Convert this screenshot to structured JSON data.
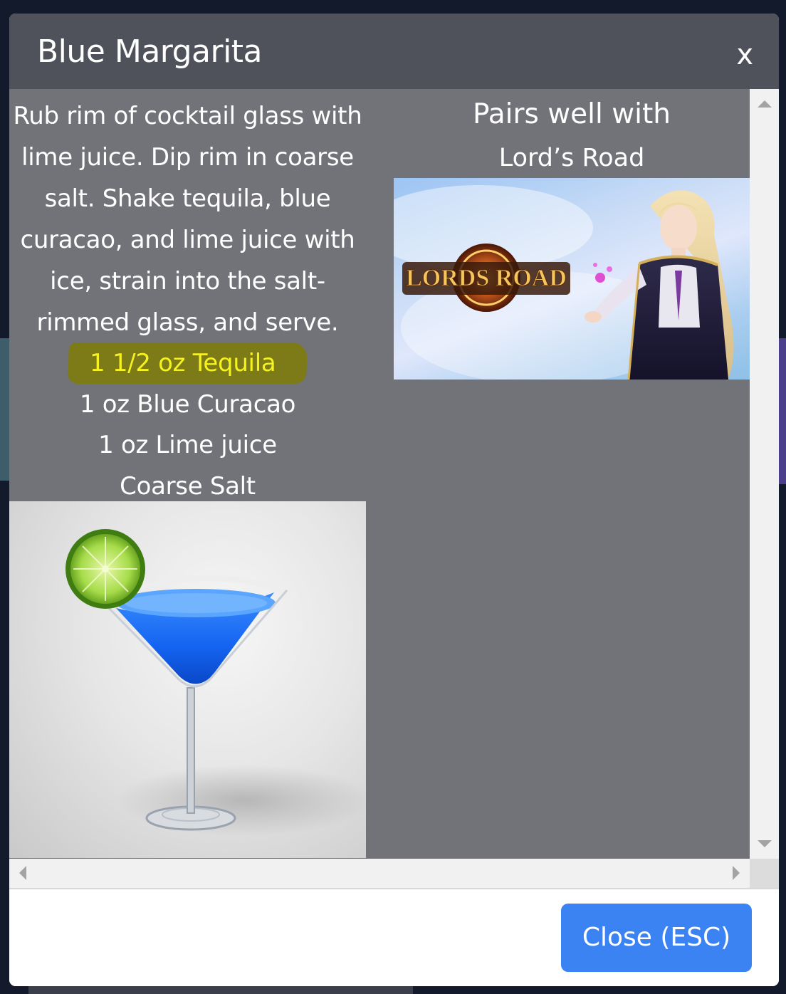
{
  "modal": {
    "title": "Blue Margarita",
    "close_x_label": "x",
    "close_button_label": "Close (ESC)"
  },
  "recipe": {
    "instructions": "Rub rim of cocktail glass with lime juice. Dip rim in coarse salt. Shake tequila, blue curacao, and lime juice with ice, strain into the salt-rimmed glass, and serve.",
    "ingredients": [
      "1 1/2 oz Tequila",
      "1 oz Blue Curacao",
      "1 oz Lime juice",
      "Coarse Salt"
    ],
    "highlighted_ingredient_index": 0,
    "highlight_text_color": "#f5f21f",
    "highlight_background_color": "#7c7b18",
    "photo_icon": "blue-margarita-cocktail-photo"
  },
  "pairing": {
    "title": "Pairs well with",
    "game_name": "Lord’s Road",
    "banner_logo_text": "LORDS ROAD",
    "banner_icon": "lords-road-game-banner"
  },
  "colors": {
    "header_bg": "#50525b",
    "content_bg": "#727279",
    "button_bg": "#3b82f3",
    "page_bg": "#121a2b"
  }
}
